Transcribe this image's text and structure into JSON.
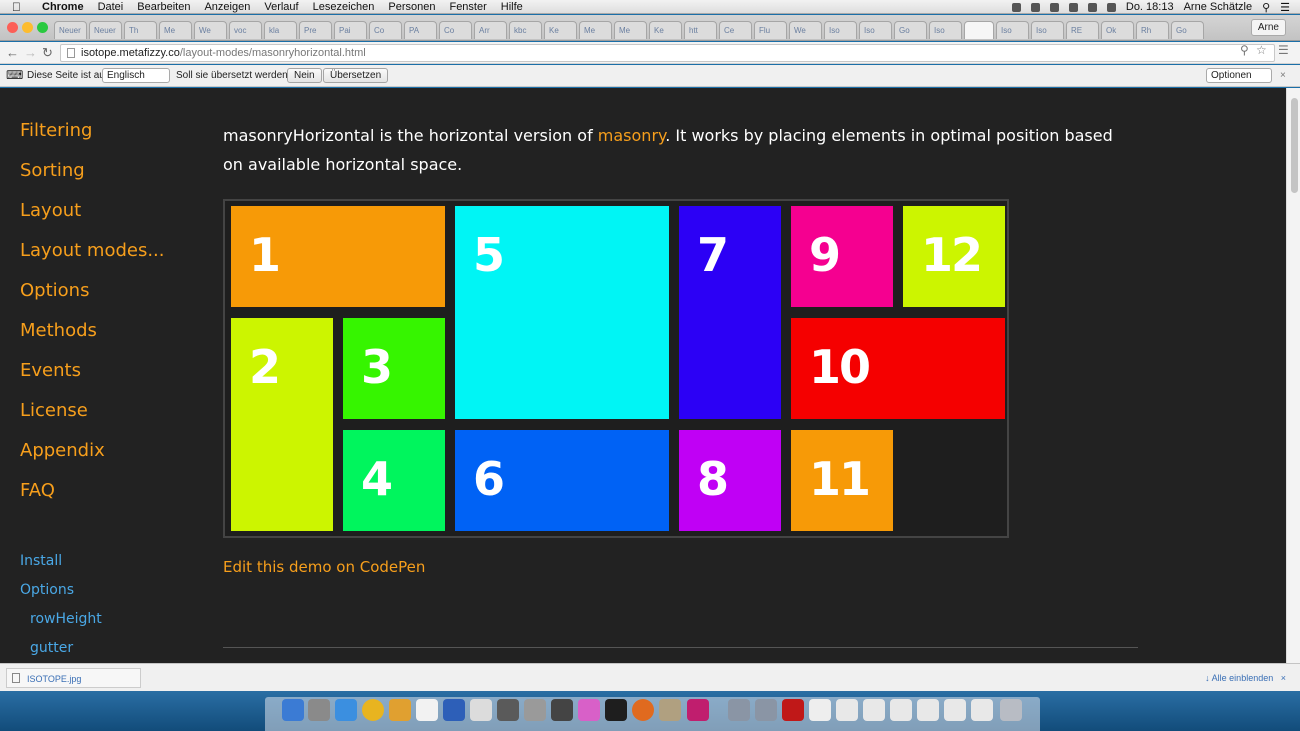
{
  "menubar": {
    "app": "Chrome",
    "items": [
      "Datei",
      "Bearbeiten",
      "Anzeigen",
      "Verlauf",
      "Lesezeichen",
      "Personen",
      "Fenster",
      "Hilfe"
    ],
    "clock": "Do. 18:13",
    "user": "Arne Schätzle"
  },
  "browser": {
    "tabs": [
      "Neuer",
      "Neuer",
      "Th",
      "Me",
      "We",
      "voc",
      "kla",
      "Pre",
      "Pai",
      "Co",
      "PA",
      "Co",
      "Arr",
      "kbc",
      "Ke",
      "Me",
      "Me",
      "Ke",
      "htt",
      "Ce",
      "Flu",
      "We",
      "Iso",
      "Iso",
      "Go",
      "Iso",
      "",
      "Iso",
      "Iso",
      "RE",
      "Ok",
      "Rh",
      "Go"
    ],
    "profile": "Arne",
    "url_host": "isotope.metafizzy.co",
    "url_path": "/layout-modes/masonryhorizontal.html"
  },
  "translate_bar": {
    "prompt": "Diese Seite ist auf",
    "language": "Englisch",
    "question": "Soll sie übersetzt werden?",
    "no_label": "Nein",
    "translate_label": "Übersetzen",
    "options_label": "Optionen"
  },
  "sidebar": {
    "items": [
      "Filtering",
      "Sorting",
      "Layout",
      "Layout modes...",
      "Options",
      "Methods",
      "Events",
      "License",
      "Appendix",
      "FAQ"
    ],
    "sub": [
      "Install",
      "Options",
      "rowHeight",
      "gutter"
    ]
  },
  "content": {
    "intro_before": "masonryHorizontal is the horizontal version of ",
    "intro_link": "masonry",
    "intro_after": ". It works by placing elements in optimal position based on available horizontal space.",
    "codepen": "Edit this demo on CodePen"
  },
  "demo_tiles": [
    {
      "label": "1",
      "color": "#f79a07"
    },
    {
      "label": "2",
      "color": "#ccf500"
    },
    {
      "label": "3",
      "color": "#36f500"
    },
    {
      "label": "4",
      "color": "#00f55d"
    },
    {
      "label": "5",
      "color": "#00f5f5"
    },
    {
      "label": "6",
      "color": "#0062f5"
    },
    {
      "label": "7",
      "color": "#2c00f5"
    },
    {
      "label": "8",
      "color": "#c000f5"
    },
    {
      "label": "9",
      "color": "#f50090"
    },
    {
      "label": "10",
      "color": "#f50000"
    },
    {
      "label": "11",
      "color": "#f79a07"
    },
    {
      "label": "12",
      "color": "#ccf500"
    }
  ],
  "downloads": {
    "file": "ISOTOPE.jpg",
    "show_all": "Alle einblenden"
  }
}
